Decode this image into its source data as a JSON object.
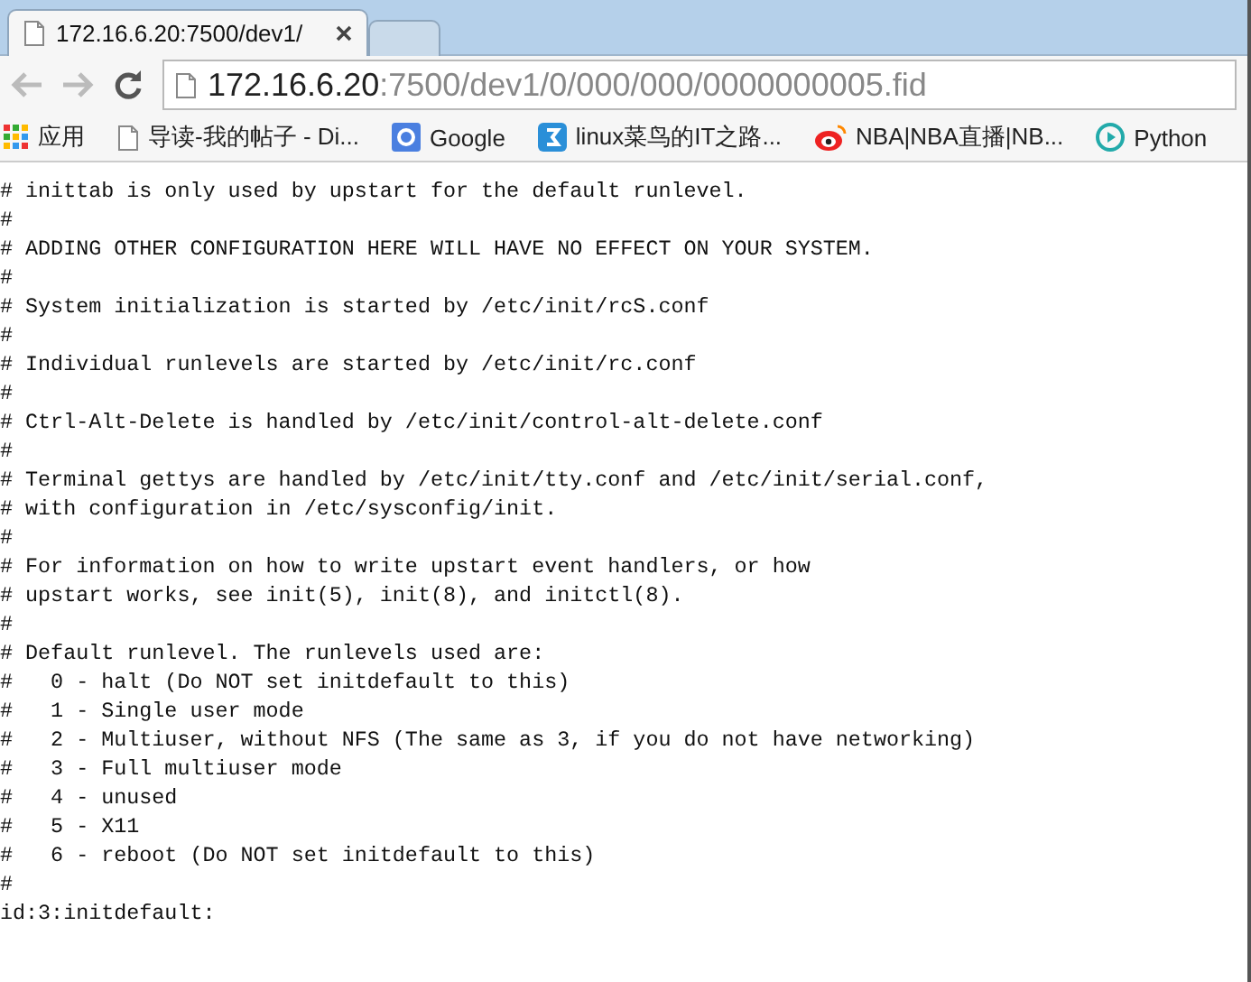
{
  "tabs": [
    {
      "title": "172.16.6.20:7500/dev1/",
      "selected": true
    },
    {
      "selected": false
    }
  ],
  "address_bar": {
    "host": "172.16.6.20",
    "path": ":7500/dev1/0/000/000/0000000005.fid"
  },
  "bookmarks": [
    {
      "kind": "apps",
      "label": "应用"
    },
    {
      "kind": "page",
      "label": "导读-我的帖子 - Di..."
    },
    {
      "kind": "google",
      "label": "Google"
    },
    {
      "kind": "blue",
      "label": "linux菜鸟的IT之路..."
    },
    {
      "kind": "weibo",
      "label": "NBA|NBA直播|NB..."
    },
    {
      "kind": "play",
      "label": "Python"
    }
  ],
  "lines": [
    "# inittab is only used by upstart for the default runlevel.",
    "#",
    "# ADDING OTHER CONFIGURATION HERE WILL HAVE NO EFFECT ON YOUR SYSTEM.",
    "#",
    "# System initialization is started by /etc/init/rcS.conf",
    "#",
    "# Individual runlevels are started by /etc/init/rc.conf",
    "#",
    "# Ctrl-Alt-Delete is handled by /etc/init/control-alt-delete.conf",
    "#",
    "# Terminal gettys are handled by /etc/init/tty.conf and /etc/init/serial.conf,",
    "# with configuration in /etc/sysconfig/init.",
    "#",
    "# For information on how to write upstart event handlers, or how",
    "# upstart works, see init(5), init(8), and initctl(8).",
    "#",
    "# Default runlevel. The runlevels used are:",
    "#   0 - halt (Do NOT set initdefault to this)",
    "#   1 - Single user mode",
    "#   2 - Multiuser, without NFS (The same as 3, if you do not have networking)",
    "#   3 - Full multiuser mode",
    "#   4 - unused",
    "#   5 - X11",
    "#   6 - reboot (Do NOT set initdefault to this)",
    "#",
    "id:3:initdefault:"
  ]
}
